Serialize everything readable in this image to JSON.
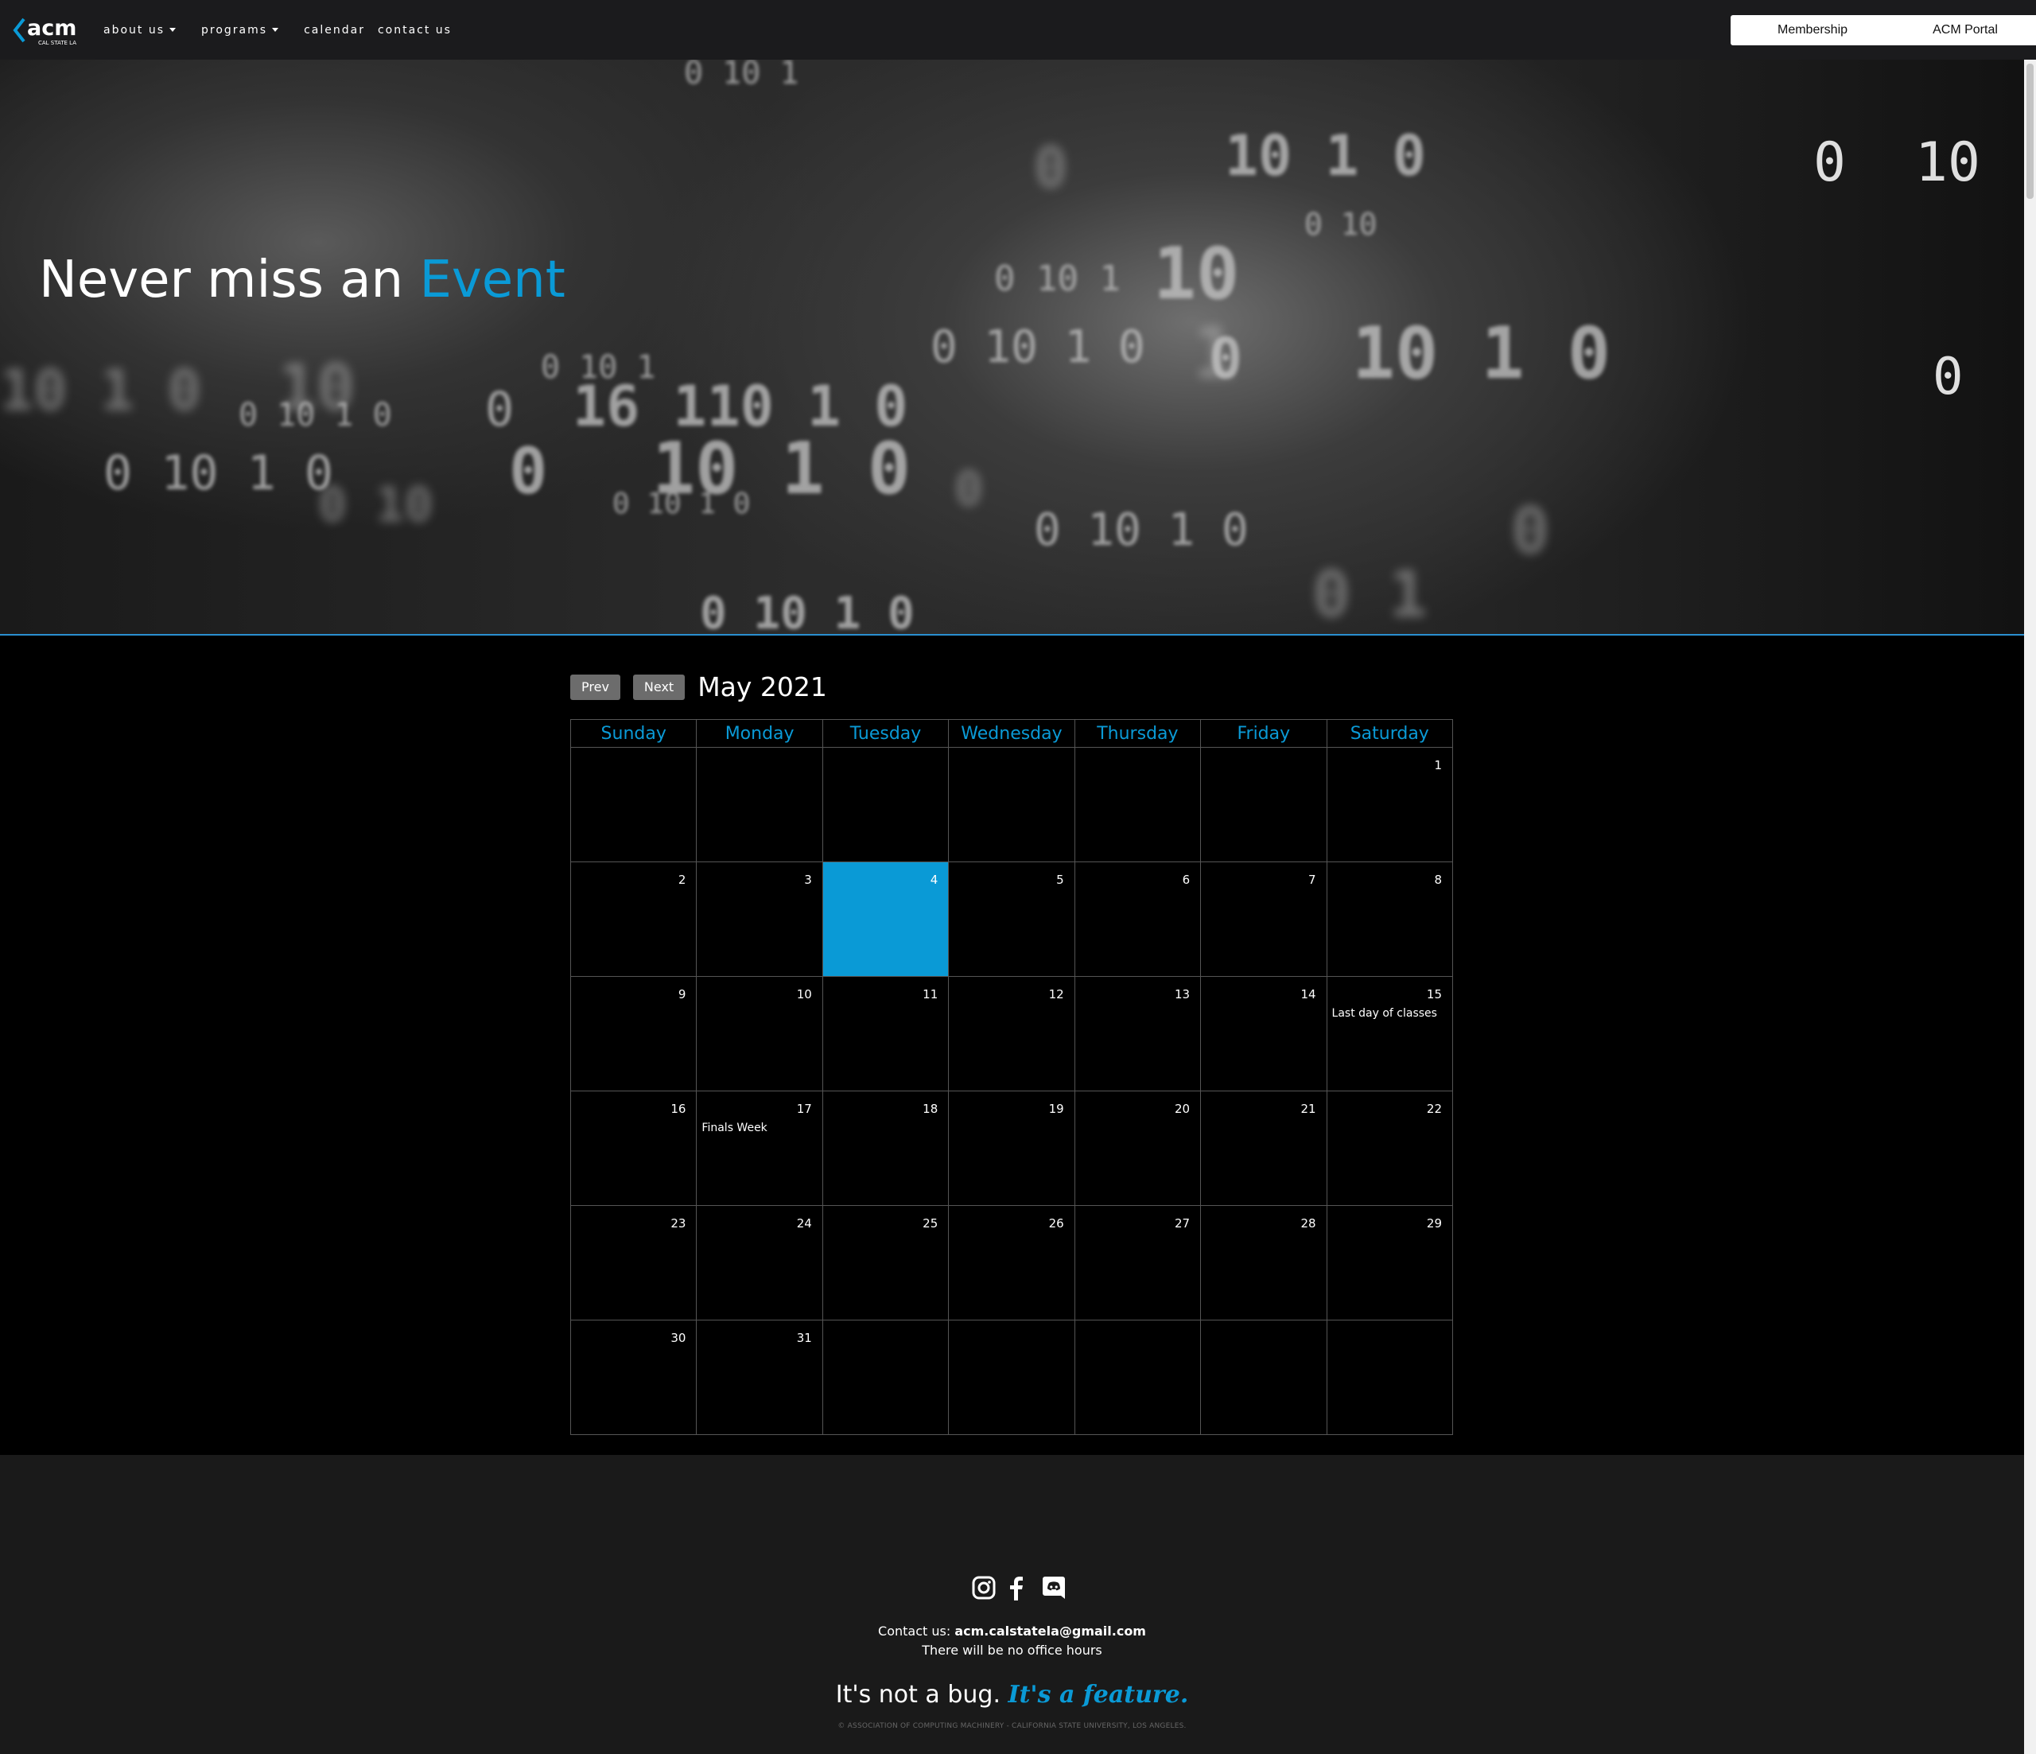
{
  "brand": {
    "logo_text": "acm",
    "logo_subtext": "CAL STATE LA"
  },
  "nav": {
    "links": [
      {
        "label": "about us",
        "dropdown": true
      },
      {
        "label": "programs",
        "dropdown": true
      },
      {
        "label": "calendar",
        "dropdown": false
      },
      {
        "label": "contact us",
        "dropdown": false
      }
    ],
    "membership_button": "Membership",
    "portal_button": "ACM Portal"
  },
  "hero": {
    "title_prefix": "Never miss an",
    "title_accent": "Event"
  },
  "calendar": {
    "prev_label": "Prev",
    "next_label": "Next",
    "month_title": "May 2021",
    "weekdays": [
      "Sunday",
      "Monday",
      "Tuesday",
      "Wednesday",
      "Thursday",
      "Friday",
      "Saturday"
    ],
    "weeks": [
      [
        {
          "day": ""
        },
        {
          "day": ""
        },
        {
          "day": ""
        },
        {
          "day": ""
        },
        {
          "day": ""
        },
        {
          "day": ""
        },
        {
          "day": "1"
        }
      ],
      [
        {
          "day": "2"
        },
        {
          "day": "3"
        },
        {
          "day": "4",
          "today": true
        },
        {
          "day": "5"
        },
        {
          "day": "6"
        },
        {
          "day": "7"
        },
        {
          "day": "8"
        }
      ],
      [
        {
          "day": "9"
        },
        {
          "day": "10"
        },
        {
          "day": "11"
        },
        {
          "day": "12"
        },
        {
          "day": "13"
        },
        {
          "day": "14"
        },
        {
          "day": "15",
          "event": "Last day of classes"
        }
      ],
      [
        {
          "day": "16"
        },
        {
          "day": "17",
          "event": "Finals Week"
        },
        {
          "day": "18"
        },
        {
          "day": "19"
        },
        {
          "day": "20"
        },
        {
          "day": "21"
        },
        {
          "day": "22"
        }
      ],
      [
        {
          "day": "23"
        },
        {
          "day": "24"
        },
        {
          "day": "25"
        },
        {
          "day": "26"
        },
        {
          "day": "27"
        },
        {
          "day": "28"
        },
        {
          "day": "29"
        }
      ],
      [
        {
          "day": "30"
        },
        {
          "day": "31"
        },
        {
          "day": ""
        },
        {
          "day": ""
        },
        {
          "day": ""
        },
        {
          "day": ""
        },
        {
          "day": ""
        }
      ]
    ]
  },
  "footer": {
    "social_icons": [
      "instagram-icon",
      "facebook-icon",
      "discord-icon"
    ],
    "contact_prefix": "Contact us:",
    "contact_email": "acm.calstatela@gmail.com",
    "office_hours": "There will be no office hours",
    "tagline_prefix": "It's not a bug.",
    "tagline_accent": "It's a feature.",
    "copyright": "© ASSOCIATION OF COMPUTING MACHINERY - CALIFORNIA STATE UNIVERSITY, LOS ANGELES."
  },
  "colors": {
    "accent": "#0a9ad6",
    "navbar": "#1b1b1d",
    "footer": "#1a1a1a"
  }
}
